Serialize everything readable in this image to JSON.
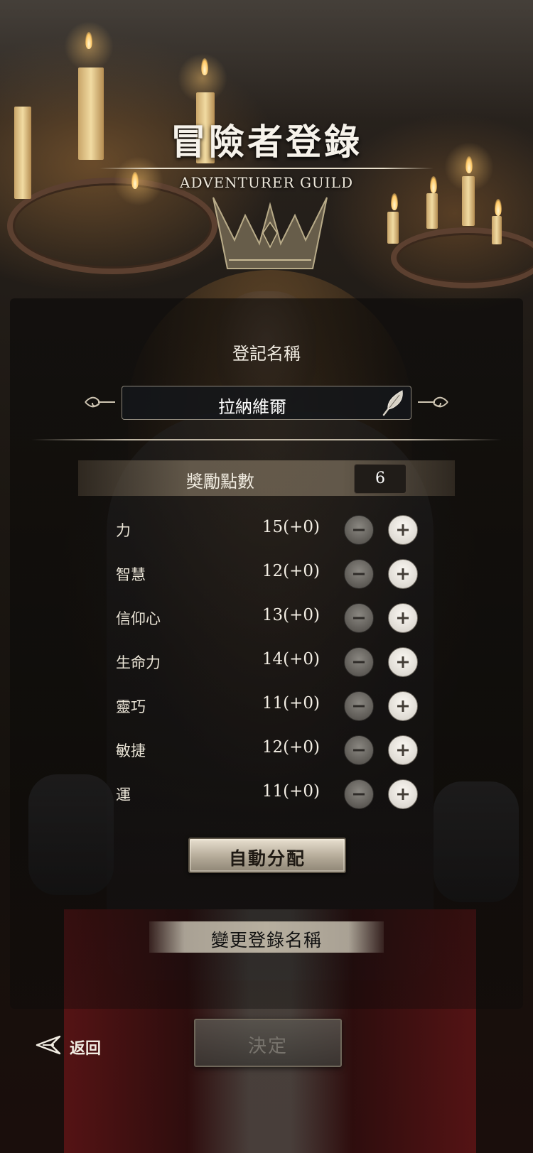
{
  "header": {
    "title": "冒險者登錄",
    "subtitle": "ADVENTURER GUILD"
  },
  "name_section": {
    "label": "登記名稱",
    "value": "拉納維爾",
    "edit_icon": "quill-icon"
  },
  "bonus": {
    "label": "獎勵點數",
    "value": "6"
  },
  "stats": [
    {
      "name": "力",
      "value": "15(+0)"
    },
    {
      "name": "智慧",
      "value": "12(+0)"
    },
    {
      "name": "信仰心",
      "value": "13(+0)"
    },
    {
      "name": "生命力",
      "value": "14(+0)"
    },
    {
      "name": "靈巧",
      "value": "11(+0)"
    },
    {
      "name": "敏捷",
      "value": "12(+0)"
    },
    {
      "name": "運",
      "value": "11(+0)"
    }
  ],
  "buttons": {
    "auto_assign": "自動分配",
    "rename": "變更登錄名稱",
    "confirm": "決定",
    "back": "返回"
  },
  "icons": {
    "minus": "minus-icon",
    "plus": "plus-icon",
    "back": "back-arrow-icon"
  },
  "colors": {
    "accent": "#b7af9f",
    "plus_button": "#dedad3",
    "minus_button": "#5d5a55",
    "confirm_disabled_text": "#77736c"
  }
}
